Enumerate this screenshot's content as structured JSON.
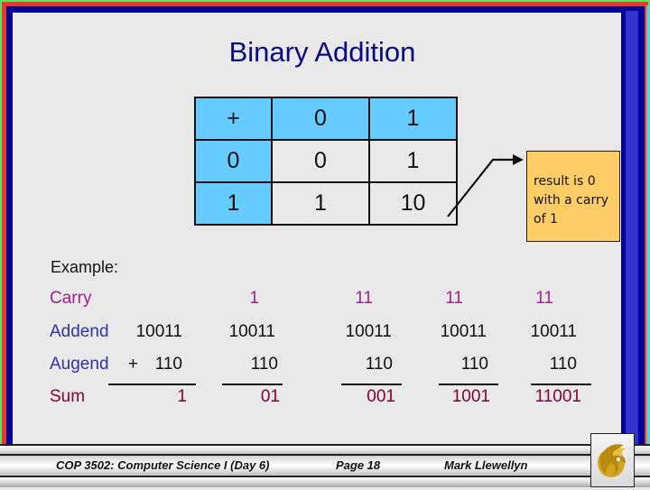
{
  "slide": {
    "title": "Binary Addition",
    "colors": {
      "background": "#e9e9e9",
      "title": "#0a0a80",
      "table_header": "#66ccff",
      "note_fill": "#ffcc66",
      "carry": "#a0208f",
      "operand_label": "#3030a8",
      "sum": "#880033"
    }
  },
  "addition_table": {
    "rows": [
      [
        "+",
        "0",
        "1"
      ],
      [
        "0",
        "0",
        "1"
      ],
      [
        "1",
        "1",
        "10"
      ]
    ]
  },
  "note": {
    "lines": [
      "result is 0",
      "with a carry",
      "of 1"
    ]
  },
  "example": {
    "heading": "Example:",
    "labels": {
      "carry": "Carry",
      "addend": "Addend",
      "augend": "Augend",
      "sum": "Sum"
    },
    "plus_sign": "+",
    "steps": [
      {
        "carry": "",
        "addend": "10011",
        "augend": "110",
        "sum": "1"
      },
      {
        "carry": "1",
        "addend": "10011",
        "augend": "110",
        "sum": "01"
      },
      {
        "carry": "11",
        "addend": "10011",
        "augend": "110",
        "sum": "001"
      },
      {
        "carry": "11",
        "addend": "10011",
        "augend": "110",
        "sum": "1001"
      },
      {
        "carry": "11",
        "addend": "10011",
        "augend": "110",
        "sum": "11001"
      }
    ]
  },
  "footer": {
    "course": "COP 3502: Computer Science I  (Day 6)",
    "page": "Page 18",
    "author": "Mark Llewellyn",
    "logo_icon": "pegasus-logo-icon"
  }
}
